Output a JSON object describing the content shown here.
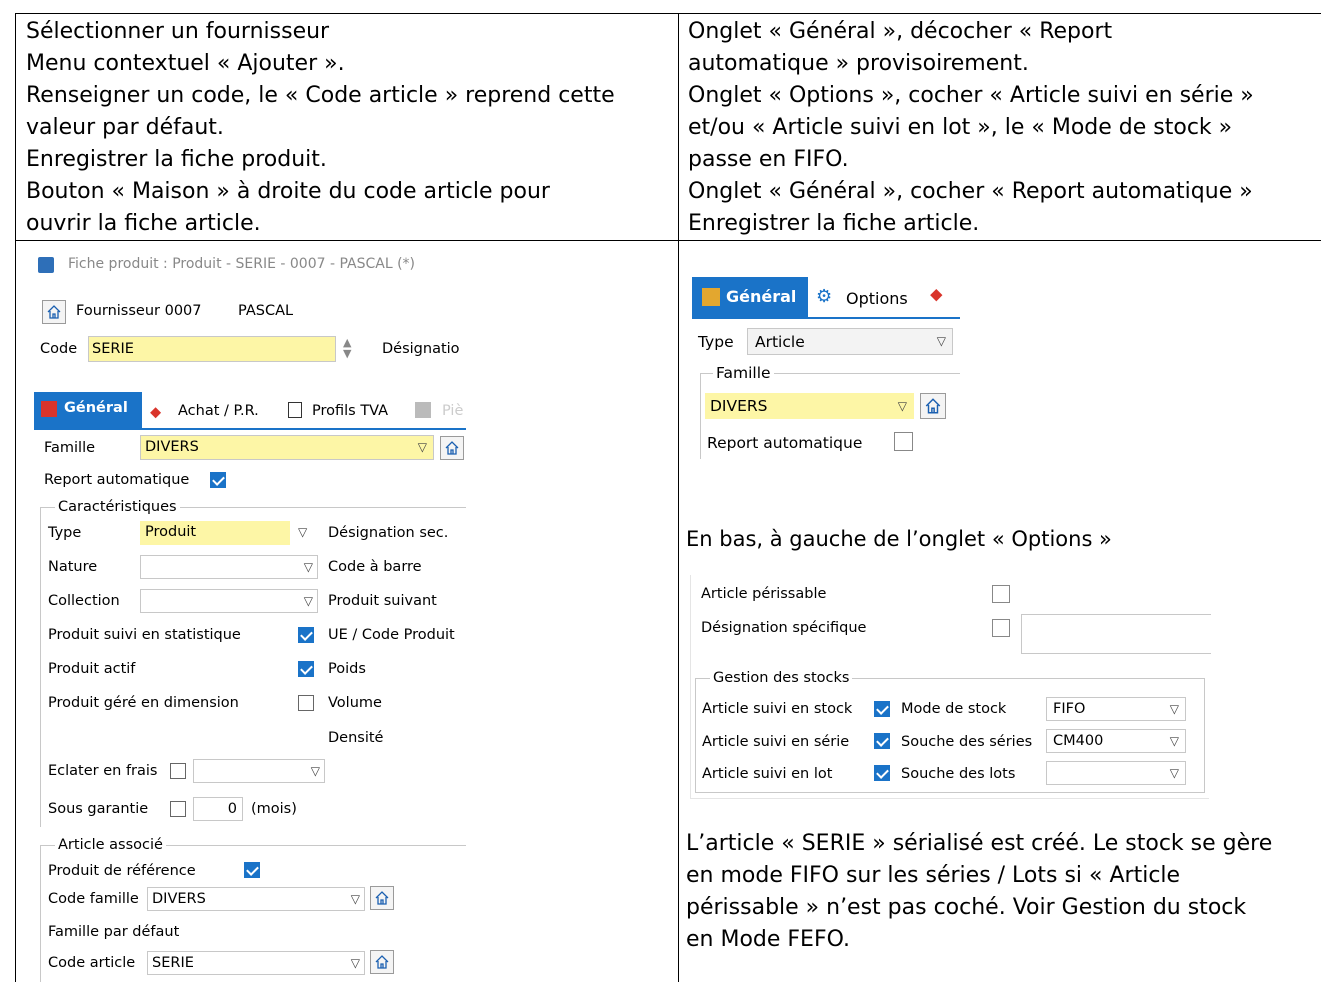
{
  "top_left": {
    "lines": [
      "Sélectionner un fournisseur",
      "Menu contextuel « Ajouter ».",
      "Renseigner un code, le « Code article » reprend cette",
      "valeur par défaut.",
      "Enregistrer la fiche produit.",
      "Bouton « Maison » à droite du code article pour",
      "ouvrir la fiche article."
    ]
  },
  "top_right": {
    "lines": [
      "Onglet « Général », décocher « Report",
      "automatique » provisoirement.",
      "Onglet « Options », cocher « Article suivi en série »",
      "et/ou « Article suivi en lot », le « Mode de stock »",
      "passe en FIFO.",
      "Onglet « Général », cocher « Report automatique »",
      "Enregistrer la fiche article."
    ]
  },
  "fiche_produit": {
    "window_title": "Fiche produit : Produit - SERIE - 0007 - PASCAL (*)",
    "fournisseur_label": "Fournisseur 0007",
    "fournisseur_name": "PASCAL",
    "code_label": "Code",
    "code_value": "SERIE",
    "designation_label": "Désignatio",
    "tabs": [
      "Général",
      "Achat / P.R.",
      "Profils TVA",
      "Piè"
    ],
    "famille_label": "Famille",
    "famille_value": "DIVERS",
    "report_label": "Report automatique",
    "report_checked": true,
    "carac_title": "Caractéristiques",
    "type_label": "Type",
    "type_value": "Produit",
    "nature_label": "Nature",
    "collection_label": "Collection",
    "suivi_stat_label": "Produit suivi en statistique",
    "suivi_stat_checked": true,
    "actif_label": "Produit actif",
    "actif_checked": true,
    "dimension_label": "Produit géré en dimension",
    "dimension_checked": false,
    "right_labels": [
      "Désignation sec.",
      "Code à barre",
      "Produit suivant",
      "UE / Code Produit",
      "Poids",
      "Volume",
      "Densité"
    ],
    "eclater_label": "Eclater en frais",
    "sous_garantie_label": "Sous garantie",
    "sous_garantie_value": "0",
    "mois_label": "(mois)",
    "article_associe_title": "Article associé",
    "produit_ref_label": "Produit de référence",
    "produit_ref_checked": true,
    "code_famille_label": "Code famille",
    "code_famille_value": "DIVERS",
    "famille_defaut_label": "Famille par défaut",
    "code_article_label": "Code article",
    "code_article_value": "SERIE"
  },
  "fiche_article": {
    "tabs": [
      "Général",
      "Options"
    ],
    "type_label": "Type",
    "type_value": "Article",
    "famille_title": "Famille",
    "famille_value": "DIVERS",
    "report_label": "Report automatique",
    "report_checked": false
  },
  "caption_options": "En bas, à gauche de l’onglet « Options »",
  "options": {
    "perissable_label": "Article périssable",
    "designation_spec_label": "Désignation spécifique",
    "gestion_title": "Gestion des stocks",
    "suivi_stock_label": "Article suivi en stock",
    "suivi_serie_label": "Article suivi en série",
    "suivi_lot_label": "Article suivi en lot",
    "mode_stock_label": "Mode de stock",
    "mode_stock_value": "FIFO",
    "souche_series_label": "Souche des séries",
    "souche_series_value": "CM400",
    "souche_lots_label": "Souche des lots"
  },
  "bottom_right": {
    "lines": [
      "L’article « SERIE » sérialisé est créé. Le stock se gère",
      "en mode FIFO sur les séries / Lots si « Article",
      "périssable » n’est pas coché. Voir Gestion du stock",
      "en Mode FEFO."
    ]
  },
  "colors": {
    "accent": "#1a73c8",
    "required_field": "#fdf6a6"
  }
}
